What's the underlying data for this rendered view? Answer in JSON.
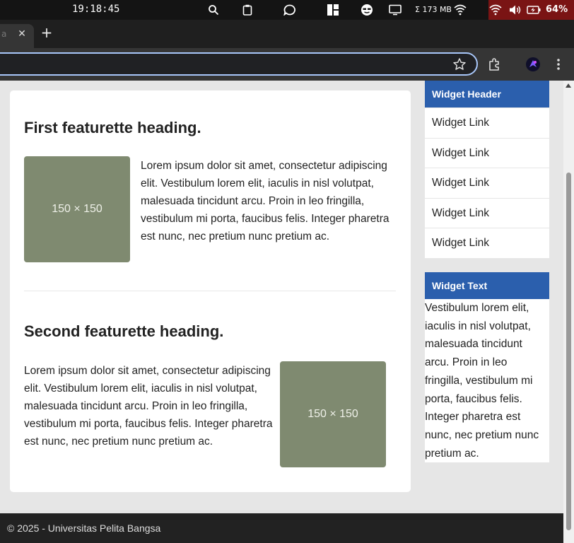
{
  "system": {
    "clock": "19:18:45",
    "memory": "Σ 173 MB",
    "battery": "64%"
  },
  "browser": {
    "tab_title": "a",
    "tab_close": "✕",
    "new_tab": "+",
    "url_placeholder": ""
  },
  "main": {
    "featurette1": {
      "heading": "First featurette heading.",
      "image_label": "150 × 150",
      "text": "Lorem ipsum dolor sit amet, consectetur adipiscing elit. Vestibulum lorem elit, iaculis in nisl volutpat, malesuada tincidunt arcu. Proin in leo fringilla, vestibulum mi porta, faucibus felis. Integer pharetra est nunc, nec pretium nunc pretium ac."
    },
    "featurette2": {
      "heading": "Second featurette heading.",
      "image_label": "150 × 150",
      "text": "Lorem ipsum dolor sit amet, consectetur adipiscing elit. Vestibulum lorem elit, iaculis in nisl volutpat, malesuada tincidunt arcu. Proin in leo fringilla, vestibulum mi porta, faucibus felis. Integer pharetra est nunc, nec pretium nunc pretium ac."
    }
  },
  "sidebar": {
    "widget1": {
      "header": "Widget Header",
      "links": [
        "Widget Link",
        "Widget Link",
        "Widget Link",
        "Widget Link",
        "Widget Link"
      ]
    },
    "widget2": {
      "header": "Widget Text",
      "text": "Vestibulum lorem elit, iaculis in nisl volutpat, malesuada tincidunt arcu. Proin in leo fringilla, vestibulum mi porta, faucibus felis. Integer pharetra est nunc, nec pretium nunc pretium ac."
    }
  },
  "footer": {
    "text": "© 2025 - Universitas Pelita Bangsa"
  },
  "colors": {
    "accent": "#2b5fad",
    "placeholder": "#7f8a70",
    "footer": "#222222"
  }
}
